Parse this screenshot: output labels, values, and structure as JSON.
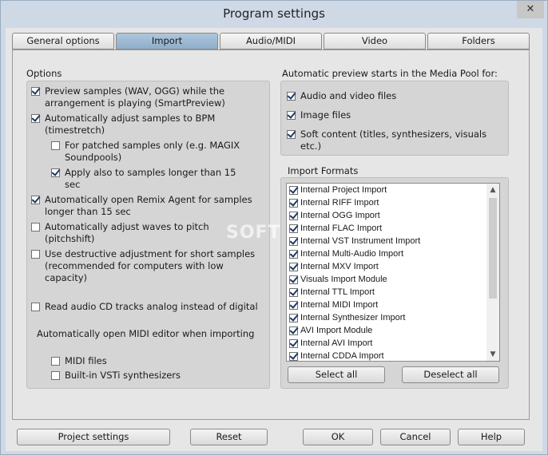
{
  "window": {
    "title": "Program settings",
    "close_glyph": "✕"
  },
  "tabs": [
    {
      "label": "General options"
    },
    {
      "label": "Import",
      "active": true
    },
    {
      "label": "Audio/MIDI"
    },
    {
      "label": "Video"
    },
    {
      "label": "Folders"
    }
  ],
  "options": {
    "title": "Options",
    "preview_samples": {
      "label": "Preview samples (WAV, OGG) while the\narrangement is playing (SmartPreview)",
      "checked": true
    },
    "adjust_bpm": {
      "label": "Automatically adjust samples to BPM\n(timestretch)",
      "checked": true
    },
    "patched_only": {
      "label": "For patched samples only (e.g. MAGIX\nSoundpools)",
      "checked": false
    },
    "apply_longer": {
      "label": "Apply also to samples longer than 15\nsec",
      "checked": true
    },
    "remix_agent": {
      "label": "Automatically open Remix Agent for samples\nlonger than 15 sec",
      "checked": true
    },
    "adjust_pitch": {
      "label": "Automatically adjust waves to pitch\n(pitchshift)",
      "checked": false
    },
    "destructive": {
      "label": "Use destructive adjustment for short samples\n(recommended for computers with low\ncapacity)",
      "checked": false
    },
    "cd_analog": {
      "label": "Read audio CD tracks analog instead of digital",
      "checked": false
    },
    "midi_editor_text": "Automatically open MIDI editor when importing",
    "midi_files": {
      "label": "MIDI files",
      "checked": false
    },
    "vsti": {
      "label": "Built-in VSTi synthesizers",
      "checked": false
    }
  },
  "preview": {
    "title": "Automatic preview starts in the Media Pool for:",
    "audio_video": {
      "label": "Audio and video files",
      "checked": true
    },
    "image": {
      "label": "Image files",
      "checked": true
    },
    "soft_content": {
      "label": "Soft content (titles, synthesizers, visuals\netc.)",
      "checked": true
    }
  },
  "import_formats": {
    "title": "Import Formats",
    "items": [
      "Internal Project Import",
      "Internal RIFF Import",
      "Internal OGG Import",
      "Internal FLAC Import",
      "Internal VST Instrument Import",
      "Internal Multi-Audio Import",
      "Internal MXV Import",
      "Visuals Import Module",
      "Internal TTL Import",
      "Internal MIDI Import",
      "Internal Synthesizer Import",
      "AVI Import Module",
      "Internal AVI Import",
      "Internal CDDA Import"
    ],
    "select_all": "Select all",
    "deselect_all": "Deselect all"
  },
  "footer": {
    "project_settings": "Project settings",
    "reset": "Reset",
    "ok": "OK",
    "cancel": "Cancel",
    "help": "Help"
  },
  "watermark": "SOFT"
}
